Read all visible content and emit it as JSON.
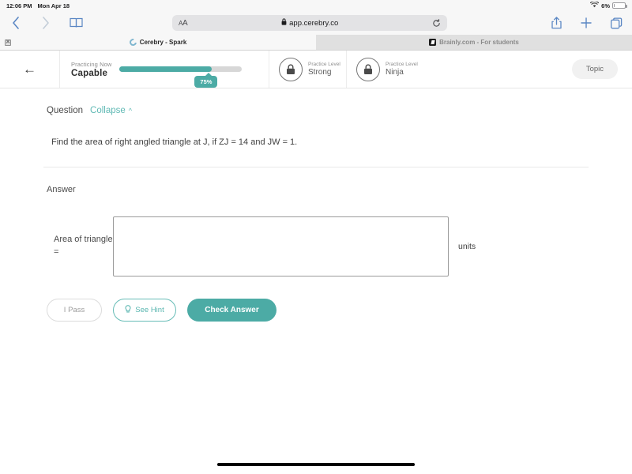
{
  "statusbar": {
    "time": "12:06 PM",
    "date": "Mon Apr 18",
    "wifi_icon": "wifi-icon",
    "battery_percent": "6%",
    "battery_icon": "battery-icon"
  },
  "browser": {
    "back_icon": "chevron-left-icon",
    "forward_icon": "chevron-right-icon",
    "bookmarks_icon": "book-icon",
    "text_size_label": "AA",
    "lock_icon": "lock-icon",
    "url": "app.cerebry.co",
    "reload_icon": "reload-icon",
    "share_icon": "share-icon",
    "new_tab_icon": "plus-icon",
    "tabs_icon": "tabs-icon",
    "tabs": [
      {
        "title": "Cerebry - Spark",
        "favicon": "cerebry-c-icon",
        "active": true,
        "close_icon": "close-icon"
      },
      {
        "title": "Brainly.com - For students",
        "favicon": "brainly-icon",
        "active": false
      }
    ]
  },
  "app_header": {
    "back_icon": "arrow-left-icon",
    "progress": {
      "label_small": "Practicing Now",
      "label_big": "Capable",
      "percent_badge": "75%",
      "percent_value": 75,
      "fill_color": "#4caba5",
      "track_color": "#d7d7d7"
    },
    "levels": [
      {
        "lock_icon": "lock-icon",
        "label_small": "Practice Level",
        "label_big": "Strong"
      },
      {
        "lock_icon": "lock-icon",
        "label_small": "Practice Level",
        "label_big": "Ninja"
      }
    ],
    "topic_button": "Topic"
  },
  "question": {
    "section_label": "Question",
    "collapse_label": "Collapse",
    "collapse_chevron": "chevron-up-icon",
    "text": "Find the area of right angled triangle at J, if ZJ = 14 and JW = 1."
  },
  "answer": {
    "section_label": "Answer",
    "field_label": "Area of triangle =",
    "input_value": "",
    "input_placeholder": "",
    "units_label": "units"
  },
  "actions": {
    "pass_label": "I Pass",
    "hint_label": "See Hint",
    "hint_icon": "lightbulb-icon",
    "check_label": "Check Answer"
  },
  "theme": {
    "accent": "#4caba5",
    "accent_light": "#5fb9b4",
    "page_bg": "#ffffff"
  }
}
